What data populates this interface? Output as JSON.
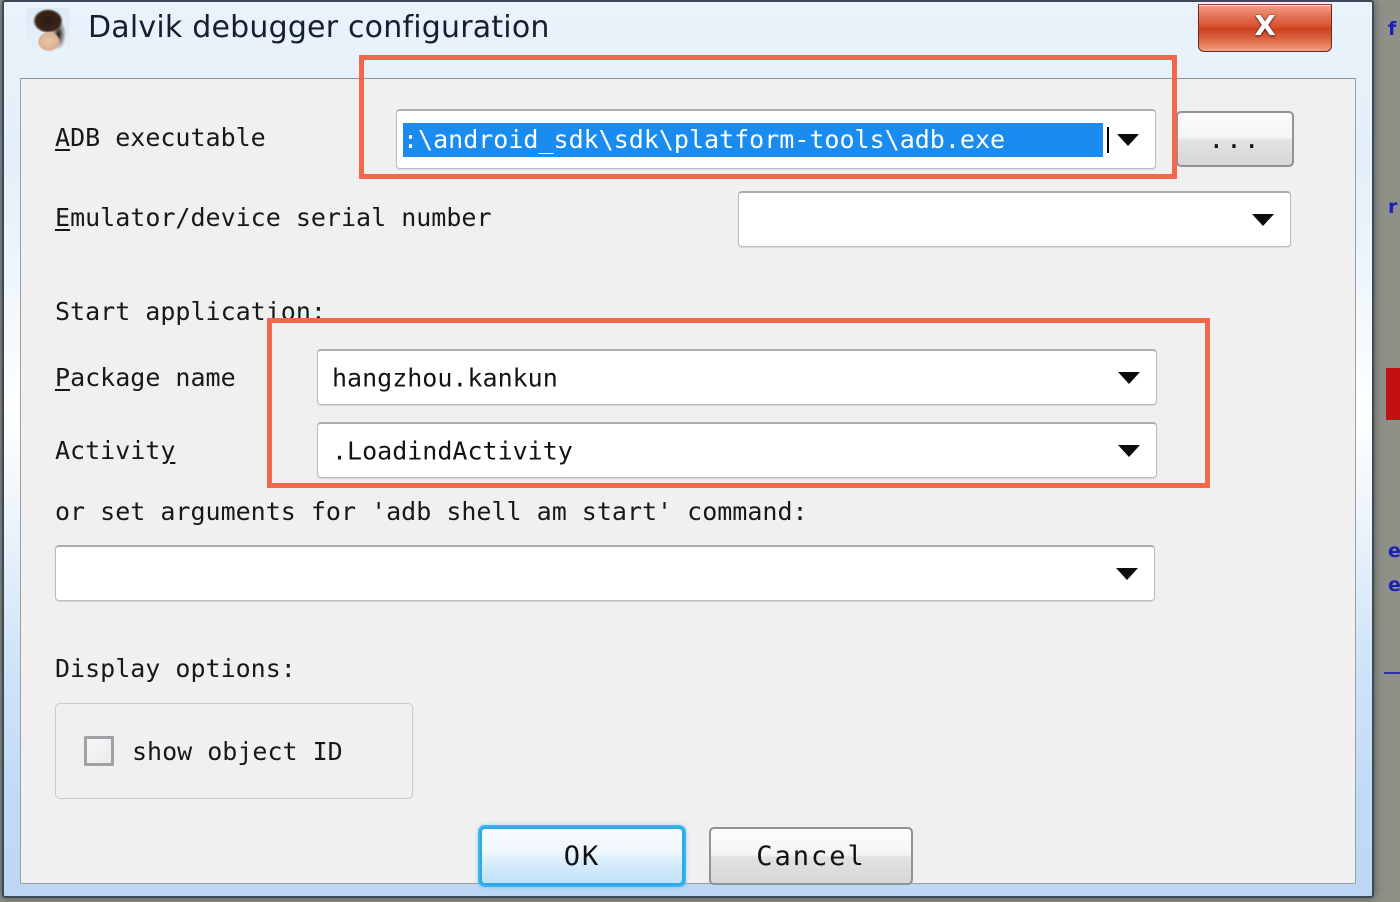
{
  "window": {
    "title": "Dalvik debugger configuration",
    "icon": "avatar-photo-icon",
    "close_label": "X"
  },
  "form": {
    "adb_executable": {
      "label": "ADB executable",
      "mnemonic": "A",
      "value": "C:\\android_sdk\\sdk\\platform-tools\\adb.exe",
      "value_display": ":\\android_sdk\\sdk\\platform-tools\\adb.exe",
      "selected": true,
      "browse_label": "..."
    },
    "emulator_serial": {
      "label": "Emulator/device serial number",
      "mnemonic": "E",
      "value": "",
      "placeholder": ""
    },
    "start_application_heading": "Start application:",
    "package_name": {
      "label": "Package name",
      "mnemonic": "P",
      "value": "hangzhou.kankun"
    },
    "activity": {
      "label": "Activity",
      "mnemonic": "y",
      "value": ".LoadindActivity"
    },
    "arguments": {
      "label": "or set arguments for 'adb shell am start' command:",
      "value": "",
      "placeholder": ""
    },
    "display_options": {
      "heading": "Display options:",
      "show_object_id": {
        "label": "show object ID",
        "checked": false
      }
    }
  },
  "buttons": {
    "ok": "OK",
    "cancel": "Cancel"
  },
  "annotations": [
    {
      "name": "adb-executable-highlight",
      "color": "#f4674d"
    },
    {
      "name": "start-application-highlight",
      "color": "#f4674d"
    }
  ],
  "background": {
    "fragments": [
      "f",
      "r",
      "e",
      "e"
    ]
  },
  "colors": {
    "annotation": "#f4674d",
    "selection": "#1a8cf0",
    "panel": "#eff0ef",
    "focus_ring": "#35b4f0",
    "close_button": "#d8512f",
    "bg_text": "#1b21b8",
    "bg_red_block": "#c21010"
  }
}
